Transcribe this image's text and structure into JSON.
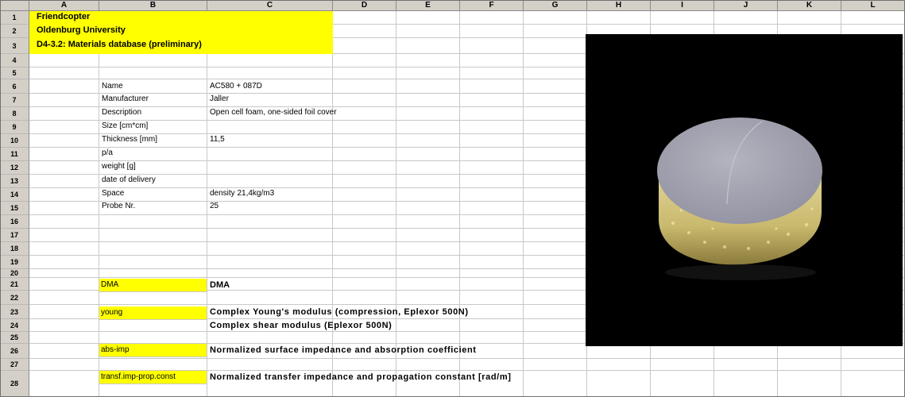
{
  "columns": [
    "A",
    "B",
    "C",
    "D",
    "E",
    "F",
    "G",
    "H",
    "I",
    "J",
    "K",
    "L"
  ],
  "rows": [
    "1",
    "2",
    "3",
    "4",
    "5",
    "6",
    "7",
    "8",
    "9",
    "10",
    "11",
    "12",
    "13",
    "14",
    "15",
    "16",
    "17",
    "18",
    "19",
    "20",
    "21",
    "22",
    "23",
    "24",
    "25",
    "26",
    "27",
    "28"
  ],
  "header": {
    "line1": "Friendcopter",
    "line2": "Oldenburg University",
    "line3": "D4-3.2: Materials database (preliminary)"
  },
  "fields": [
    {
      "label": "Name",
      "value": "AC580 + 087D"
    },
    {
      "label": "Manufacturer",
      "value": "Jaller"
    },
    {
      "label": "Description",
      "value": "Open cell foam, one-sided foil cover"
    },
    {
      "label": "Size [cm*cm]",
      "value": ""
    },
    {
      "label": "Thickness [mm]",
      "value": "11,5"
    },
    {
      "label": "p/a",
      "value": ""
    },
    {
      "label": "weight [g]",
      "value": ""
    },
    {
      "label": "date of delivery",
      "value": ""
    },
    {
      "label": "Space",
      "value": "density 21,4kg/m3"
    },
    {
      "label": "Probe Nr.",
      "value": "25"
    }
  ],
  "links": [
    {
      "key": "DMA",
      "title": "DMA"
    },
    {
      "key": "young",
      "title": "Complex Young's modulus (compression, Eplexor 500N)",
      "title2": "Complex shear modulus (Eplexor 500N)"
    },
    {
      "key": "abs-imp",
      "title": "Normalized surface impedance and absorption coefficient"
    },
    {
      "key": "transf.imp-prop.const",
      "title": "Normalized transfer impedance and propagation constant [rad/m]"
    }
  ],
  "colors": {
    "highlight": "#ffff00",
    "header_bg": "#d4d0c8",
    "grid": "#c8c8c8",
    "photo_bg": "#000000"
  }
}
